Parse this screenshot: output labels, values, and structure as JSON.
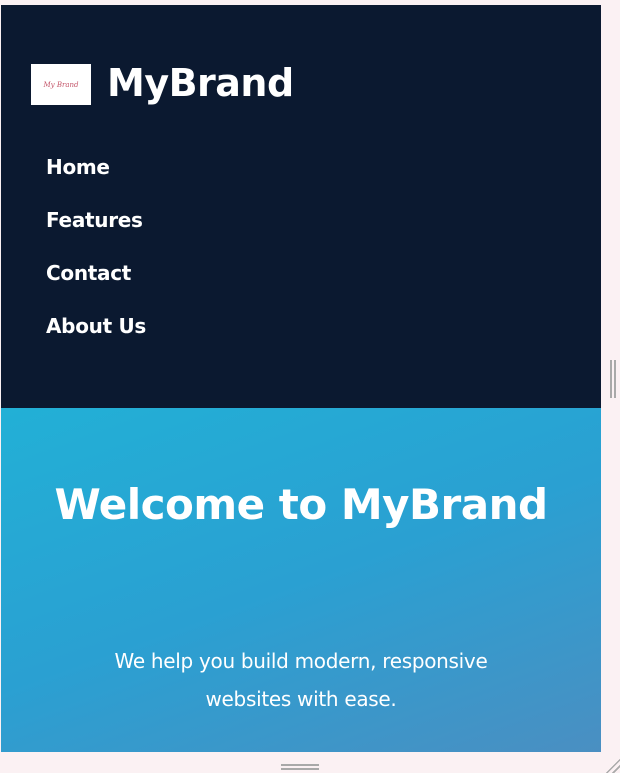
{
  "header": {
    "logo_text": "My Brand",
    "brand": "MyBrand",
    "nav": [
      {
        "label": "Home"
      },
      {
        "label": "Features"
      },
      {
        "label": "Contact"
      },
      {
        "label": "About Us"
      }
    ]
  },
  "hero": {
    "title": "Welcome to MyBrand",
    "subtitle": "We help you build modern, responsive websites with ease."
  },
  "colors": {
    "header_bg": "#0b1930",
    "hero_start": "#22b0d6",
    "hero_end": "#4a8fc2",
    "page_bg": "#fbf1f3"
  }
}
